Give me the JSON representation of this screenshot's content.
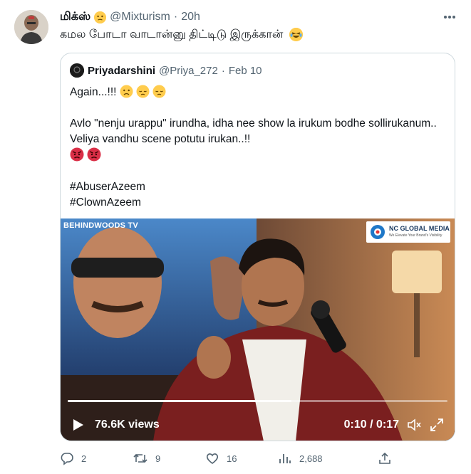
{
  "tweet": {
    "display_name": "மிக்ஸ்",
    "handle": "@Mixturism",
    "separator": "·",
    "time": "20h",
    "text": "கமல போடா வாடான்னு திட்டிடு இருக்கான்",
    "more_icon": "ellipsis-icon"
  },
  "quote": {
    "display_name": "Priyadarshini",
    "handle": "@Priya_272",
    "separator": "·",
    "date": "Feb 10",
    "lines": {
      "l1": "Again...!!!",
      "l2": "Avlo \"nenju urappu\" irundha, idha nee show la irukum bodhe sollirukanum.. Veliya vandhu scene potutu irukan..!!",
      "l3": "#AbuserAzeem",
      "l4": "#ClownAzeem"
    },
    "video": {
      "watermark_left": "BEHINDWOODS TV",
      "badge_name": "NC GLOBAL MEDIA",
      "badge_tagline": "We Elevate Your Brand's Visibility",
      "views": "76.6K views",
      "timecode": "0:10 / 0:17",
      "progress_fraction": 0.59
    }
  },
  "actions": {
    "replies": "2",
    "retweets": "9",
    "likes": "16",
    "views": "2,688"
  },
  "colors": {
    "text": "#0f1419",
    "muted": "#536471",
    "border": "#cfd9de",
    "emoji": "#ffcc4d"
  }
}
